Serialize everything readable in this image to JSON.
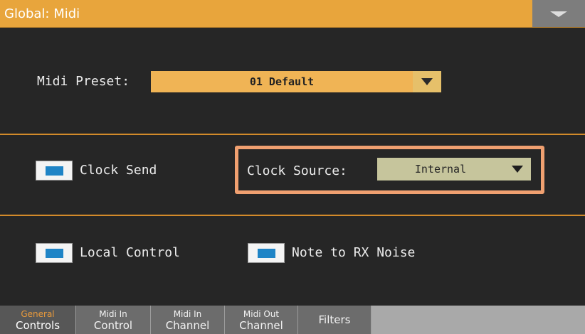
{
  "window": {
    "title": "Global: Midi",
    "menu_icon": "triangle-down-icon"
  },
  "midi_preset": {
    "label": "Midi Preset:",
    "value": "01 Default",
    "arrow_icon": "dropdown-arrow-icon"
  },
  "clock": {
    "send_label": "Clock Send",
    "source_label": "Clock Source:",
    "source_value": "Internal",
    "arrow_icon": "dropdown-arrow-icon"
  },
  "options": {
    "local_control_label": "Local Control",
    "note_to_rx_noise_label": "Note to RX Noise"
  },
  "tabs": [
    {
      "line1": "General",
      "line2": "Controls"
    },
    {
      "line1": "Midi In",
      "line2": "Control"
    },
    {
      "line1": "Midi In",
      "line2": "Channel"
    },
    {
      "line1": "Midi Out",
      "line2": "Channel"
    },
    {
      "line1": "Filters"
    }
  ],
  "colors": {
    "title_bar": "#e8a53c",
    "divider": "#d28a2a",
    "highlight": "#f0a070",
    "checkbox_mark": "#1f84c6"
  }
}
